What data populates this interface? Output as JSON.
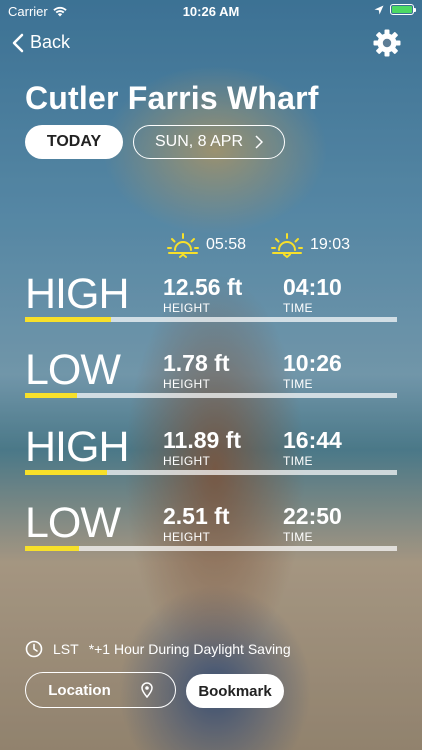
{
  "status_bar": {
    "carrier": "Carrier",
    "time": "10:26 AM"
  },
  "nav": {
    "back_label": "Back"
  },
  "title": "Cutler Farris Wharf",
  "date_tabs": {
    "today_label": "TODAY",
    "date_label": "SUN, 8 APR"
  },
  "sun": {
    "sunrise": "05:58",
    "sunset": "19:03"
  },
  "tides": [
    {
      "state": "HIGH",
      "height": "12.56 ft",
      "height_label": "HEIGHT",
      "time": "04:10",
      "time_label": "TIME",
      "level": 0.23
    },
    {
      "state": "LOW",
      "height": "1.78 ft",
      "height_label": "HEIGHT",
      "time": "10:26",
      "time_label": "TIME",
      "level": 0.14
    },
    {
      "state": "HIGH",
      "height": "11.89 ft",
      "height_label": "HEIGHT",
      "time": "16:44",
      "time_label": "TIME",
      "level": 0.22
    },
    {
      "state": "LOW",
      "height": "2.51 ft",
      "height_label": "HEIGHT",
      "time": "22:50",
      "time_label": "TIME",
      "level": 0.145
    }
  ],
  "timezone_note": {
    "zone": "LST",
    "text": "*+1 Hour During Daylight Saving"
  },
  "buttons": {
    "location_label": "Location",
    "bookmark_label": "Bookmark"
  },
  "colors": {
    "accent_yellow": "#f7e02a",
    "battery_green": "#4cd964"
  }
}
